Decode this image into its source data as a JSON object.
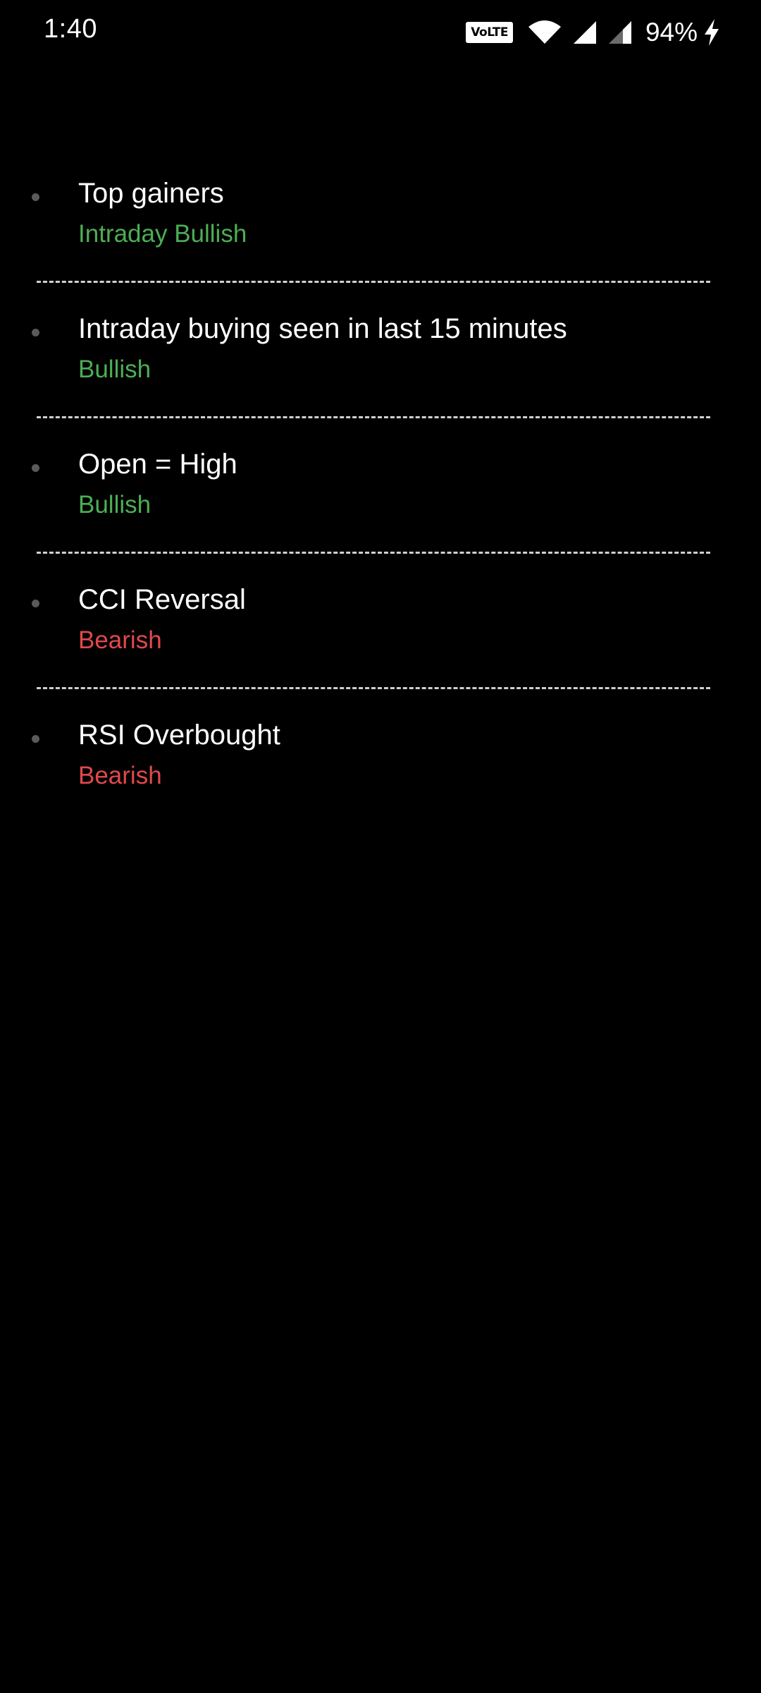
{
  "status_bar": {
    "time": "1:40",
    "volte_label": "VoLTE",
    "battery_percent": "94%",
    "icons": [
      "wifi-icon",
      "cell-signal-icon",
      "cell-signal-icon",
      "charging-bolt-icon"
    ]
  },
  "colors": {
    "bullish": "#4cae55",
    "bearish": "#e0494b"
  },
  "items": [
    {
      "title": "Top gainers",
      "sentiment": "Intraday Bullish",
      "type": "bullish"
    },
    {
      "title": "Intraday buying seen in last 15 minutes",
      "sentiment": "Bullish",
      "type": "bullish"
    },
    {
      "title": "Open = High",
      "sentiment": "Bullish",
      "type": "bullish"
    },
    {
      "title": "CCI Reversal",
      "sentiment": "Bearish",
      "type": "bearish"
    },
    {
      "title": "RSI Overbought",
      "sentiment": "Bearish",
      "type": "bearish"
    }
  ]
}
